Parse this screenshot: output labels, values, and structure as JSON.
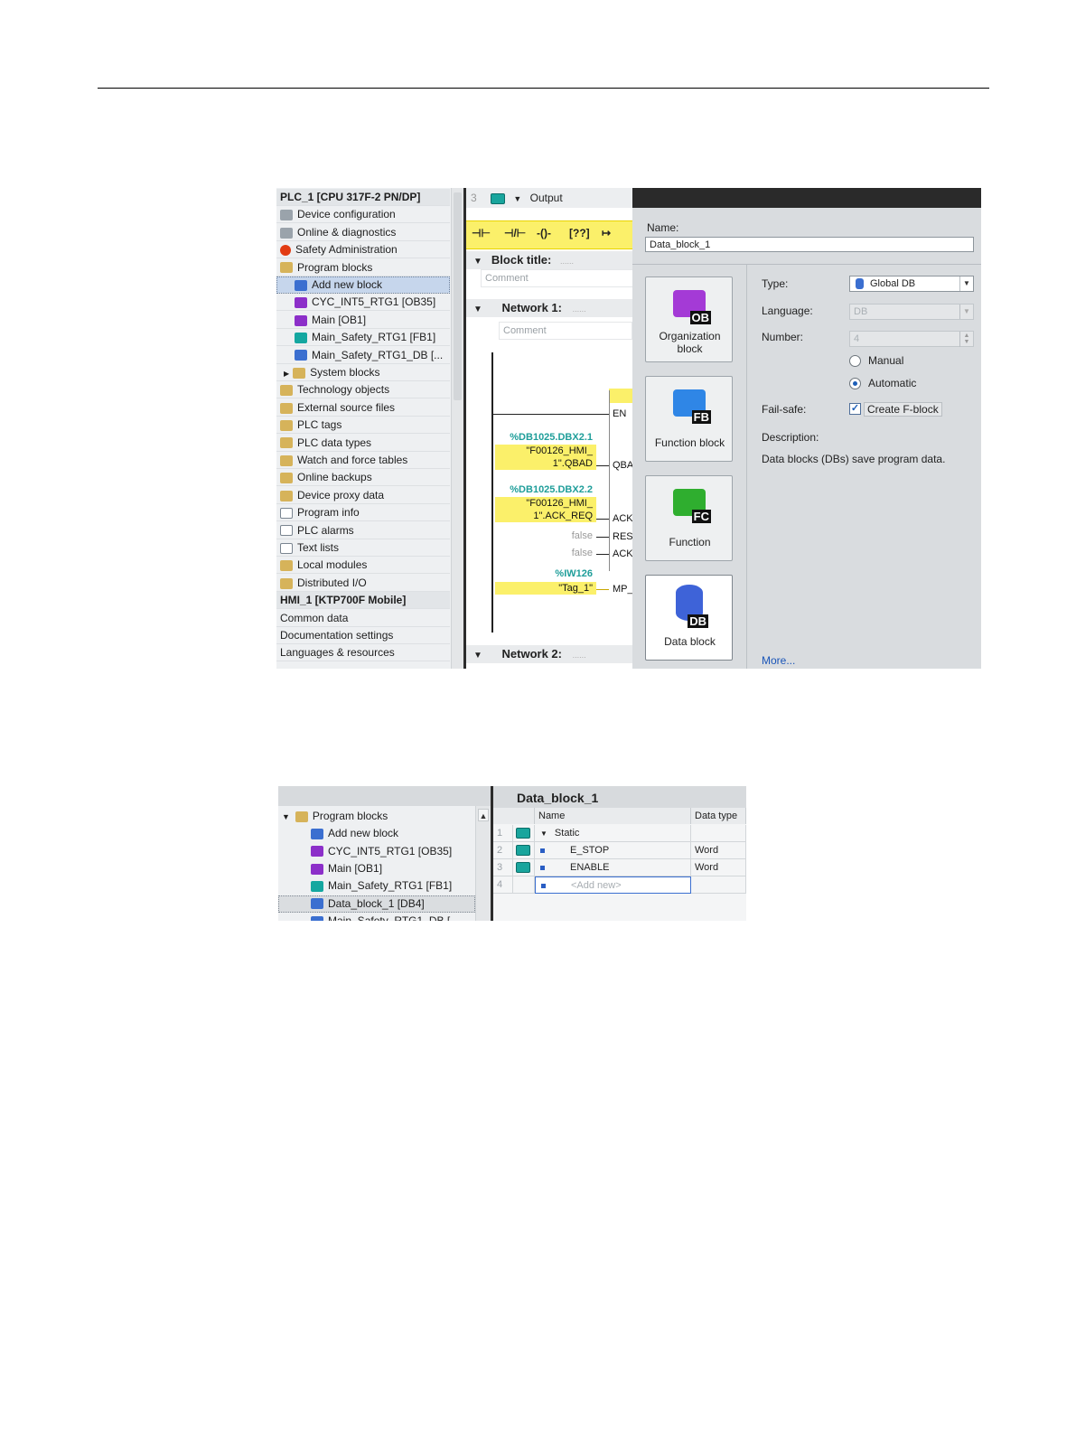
{
  "shot1": {
    "project_tree": [
      {
        "label": "PLC_1 [CPU 317F-2 PN/DP]",
        "icon": "none",
        "indent": 0,
        "header": true
      },
      {
        "label": "Device configuration",
        "icon": "device-config-icon",
        "indent": 0
      },
      {
        "label": "Online & diagnostics",
        "icon": "online-diagnostics-icon",
        "indent": 0
      },
      {
        "label": "Safety Administration",
        "icon": "safety-icon",
        "indent": 0
      },
      {
        "label": "Program blocks",
        "icon": "folder-icon",
        "indent": 0
      },
      {
        "label": "Add new block",
        "icon": "add-block-icon",
        "indent": 1,
        "selected": true
      },
      {
        "label": "CYC_INT5_RTG1 [OB35]",
        "icon": "ob-icon",
        "indent": 1
      },
      {
        "label": "Main [OB1]",
        "icon": "ob-icon",
        "indent": 1
      },
      {
        "label": "Main_Safety_RTG1 [FB1]",
        "icon": "fb-icon",
        "indent": 1
      },
      {
        "label": "Main_Safety_RTG1_DB [...",
        "icon": "db-icon",
        "indent": 1
      },
      {
        "label": "System blocks",
        "icon": "folder-icon",
        "indent": 0,
        "expander": true
      },
      {
        "label": "Technology objects",
        "icon": "folder-icon",
        "indent": 0
      },
      {
        "label": "External source files",
        "icon": "folder-icon",
        "indent": 0
      },
      {
        "label": "PLC tags",
        "icon": "folder-icon",
        "indent": 0
      },
      {
        "label": "PLC data types",
        "icon": "folder-icon",
        "indent": 0
      },
      {
        "label": "Watch and force tables",
        "icon": "folder-icon",
        "indent": 0
      },
      {
        "label": "Online backups",
        "icon": "folder-icon",
        "indent": 0
      },
      {
        "label": "Device proxy data",
        "icon": "folder-icon",
        "indent": 0
      },
      {
        "label": "Program info",
        "icon": "doc-icon",
        "indent": 0
      },
      {
        "label": "PLC alarms",
        "icon": "doc-icon",
        "indent": 0
      },
      {
        "label": "Text lists",
        "icon": "doc-icon",
        "indent": 0
      },
      {
        "label": "Local modules",
        "icon": "folder-icon",
        "indent": 0
      },
      {
        "label": "Distributed I/O",
        "icon": "folder-icon",
        "indent": 0
      },
      {
        "label": "HMI_1 [KTP700F Mobile]",
        "icon": "none",
        "indent": 0,
        "header": true
      },
      {
        "label": "Common data",
        "icon": "none",
        "indent": 0
      },
      {
        "label": "Documentation settings",
        "icon": "none",
        "indent": 0
      },
      {
        "label": "Languages & resources",
        "icon": "none",
        "indent": 0
      }
    ],
    "editor": {
      "row_number": "3",
      "output_label": "Output",
      "toolbar_symbols": [
        "⊣⊢",
        "⊣/⊢",
        "-()-",
        "[??]",
        "↦"
      ],
      "block_title": "Block title:",
      "block_title_dots": "......",
      "comment": "Comment",
      "network1": "Network 1:",
      "network1_dots": "......",
      "network2": "Network 2:",
      "network2_dots": "......",
      "operands": [
        {
          "address": "%DB1025.DBX2.1",
          "tag_line1": "\"F00126_HMI_",
          "tag_line2": "1\".QBAD",
          "pin": "QBA"
        },
        {
          "address": "%DB1025.DBX2.2",
          "tag_line1": "\"F00126_HMI_",
          "tag_line2": "1\".ACK_REQ",
          "pin": "ACK"
        }
      ],
      "false_rows": [
        {
          "value": "false",
          "pin": "RES"
        },
        {
          "value": "false",
          "pin": "ACK"
        }
      ],
      "input_word": {
        "address": "%IW126",
        "tag": "\"Tag_1\"",
        "pin": "MP_"
      },
      "en_pin": "EN"
    },
    "dialog": {
      "name_label": "Name:",
      "name_value": "Data_block_1",
      "tiles": [
        {
          "caption": "Organization block",
          "badge": "OB",
          "color": "#a43ad6"
        },
        {
          "caption": "Function block",
          "badge": "FB",
          "color": "#2f86e6"
        },
        {
          "caption": "Function",
          "badge": "FC",
          "color": "#2fae2f"
        },
        {
          "caption": "Data block",
          "badge": "DB",
          "color": "#3e63d8",
          "selected": true
        }
      ],
      "type_label": "Type:",
      "type_value": "Global DB",
      "language_label": "Language:",
      "language_value": "DB",
      "number_label": "Number:",
      "number_value": "4",
      "manual_label": "Manual",
      "automatic_label": "Automatic",
      "numbering_mode": "Automatic",
      "failsafe_label": "Fail-safe:",
      "create_fblock_label": "Create F-block",
      "create_fblock_checked": true,
      "description_label": "Description:",
      "description_text": "Data blocks (DBs) save program data.",
      "more_link": "More..."
    }
  },
  "shot2": {
    "tree": [
      {
        "label": "Program blocks",
        "icon": "folder-icon",
        "expander": true
      },
      {
        "label": "Add new block",
        "icon": "add-block-icon"
      },
      {
        "label": "CYC_INT5_RTG1 [OB35]",
        "icon": "ob-icon"
      },
      {
        "label": "Main [OB1]",
        "icon": "ob-icon"
      },
      {
        "label": "Main_Safety_RTG1 [FB1]",
        "icon": "fb-icon"
      },
      {
        "label": "Data_block_1 [DB4]",
        "icon": "db-icon",
        "selected": true
      },
      {
        "label": "Main_Safety_RTG1_DB [",
        "icon": "db-icon"
      }
    ],
    "db_title": "Data_block_1",
    "columns": [
      "Name",
      "Data type"
    ],
    "rows": [
      {
        "num": "1",
        "name": "Static",
        "type": "",
        "kind": "group"
      },
      {
        "num": "2",
        "name": "E_STOP",
        "type": "Word",
        "kind": "var"
      },
      {
        "num": "3",
        "name": "ENABLE",
        "type": "Word",
        "kind": "var"
      },
      {
        "num": "4",
        "name": "<Add new>",
        "type": "",
        "kind": "new"
      }
    ]
  }
}
